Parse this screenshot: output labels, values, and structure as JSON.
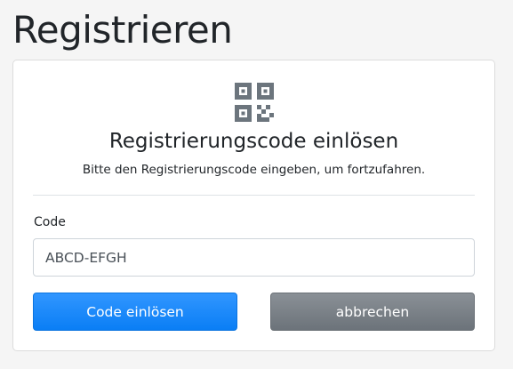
{
  "page": {
    "title": "Registrieren"
  },
  "card": {
    "icon": "qr-code-icon",
    "title": "Registrierungscode einlösen",
    "subtitle": "Bitte den Registrierungscode eingeben, um fortzufahren."
  },
  "form": {
    "code_label": "Code",
    "code_value": "ABCD-EFGH"
  },
  "actions": {
    "redeem_label": "Code einlösen",
    "cancel_label": "abbrechen"
  },
  "colors": {
    "primary": "#1a87fa",
    "secondary": "#7a8087",
    "icon": "#6c757d"
  }
}
